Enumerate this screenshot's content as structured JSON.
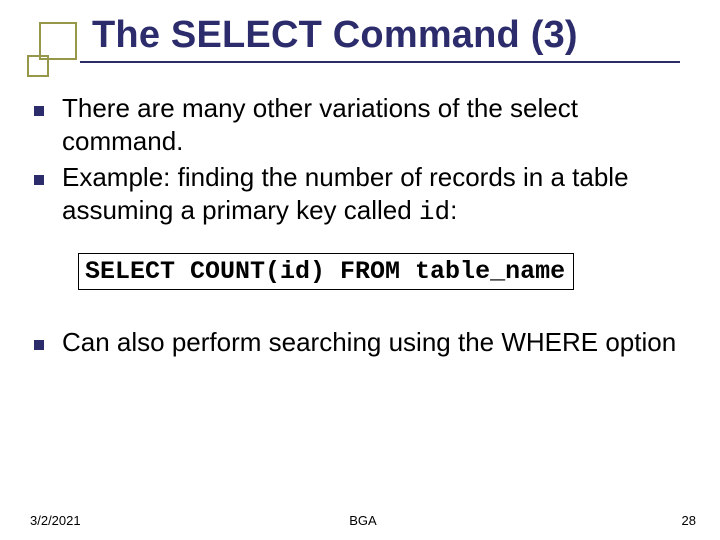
{
  "title": "The SELECT Command (3)",
  "bullets": {
    "b1": "There are many other variations of the select command.",
    "b2_pre": "Example: finding the number of records in a table assuming a primary key called ",
    "b2_code": "id",
    "b2_post": ":",
    "b3": "Can also perform searching using the WHERE option"
  },
  "code": "SELECT COUNT(id) FROM table_name",
  "footer": {
    "date": "3/2/2021",
    "center": "BGA",
    "page": "28"
  }
}
